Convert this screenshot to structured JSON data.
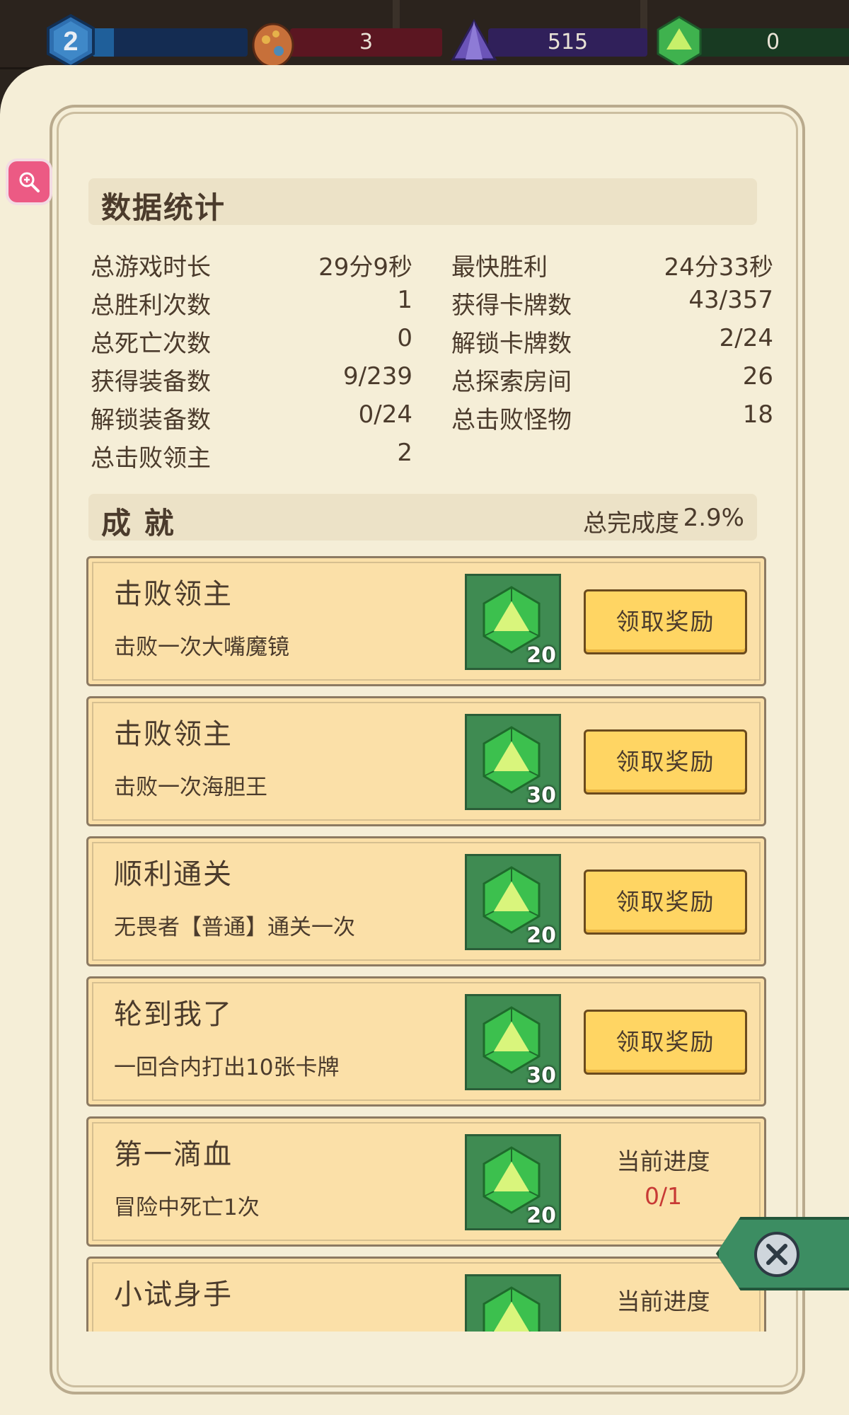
{
  "resources": {
    "level": "2",
    "red": "3",
    "purple": "515",
    "green": "0"
  },
  "stats": {
    "title": "数据统计",
    "left": [
      {
        "label": "总游戏时长",
        "value": "29分9秒"
      },
      {
        "label": "总胜利次数",
        "value": "1"
      },
      {
        "label": "总死亡次数",
        "value": "0"
      },
      {
        "label": "获得装备数",
        "value": "9/239"
      },
      {
        "label": "解锁装备数",
        "value": "0/24"
      },
      {
        "label": "总击败领主",
        "value": "2"
      }
    ],
    "right": [
      {
        "label": "最快胜利",
        "value": "24分33秒"
      },
      {
        "label": "获得卡牌数",
        "value": "43/357"
      },
      {
        "label": "解锁卡牌数",
        "value": "2/24"
      },
      {
        "label": "总探索房间",
        "value": "26"
      },
      {
        "label": "总击败怪物",
        "value": "18"
      }
    ]
  },
  "achievements": {
    "title": "成 就",
    "completion_label": "总完成度",
    "completion_value": "2.9%",
    "claim_label": "领取奖励",
    "progress_label": "当前进度",
    "items": [
      {
        "title": "击败领主",
        "desc": "击败一次大嘴魔镜",
        "reward": "20",
        "state": "claim"
      },
      {
        "title": "击败领主",
        "desc": "击败一次海胆王",
        "reward": "30",
        "state": "claim"
      },
      {
        "title": "顺利通关",
        "desc": "无畏者【普通】通关一次",
        "reward": "20",
        "state": "claim"
      },
      {
        "title": "轮到我了",
        "desc": "一回合内打出10张卡牌",
        "reward": "30",
        "state": "claim"
      },
      {
        "title": "第一滴血",
        "desc": "冒险中死亡1次",
        "reward": "20",
        "state": "progress",
        "progress": "0/1"
      },
      {
        "title": "小试身手",
        "desc": "",
        "reward": "",
        "state": "progress",
        "progress": ""
      }
    ]
  },
  "icons": {
    "level": "hexagon-level-icon",
    "red": "red-egg-icon",
    "purple": "purple-crystal-icon",
    "green": "green-d20-icon",
    "reward": "green-d20-gem-icon",
    "zoom": "zoom-in-icon",
    "close": "close-icon"
  },
  "colors": {
    "paper": "#f5eed7",
    "card": "#fbe0a8",
    "claim_button": "#ffd563",
    "reward_bg": "#3f8b52",
    "progress_value": "#c83a35",
    "close_tab": "#3c8d62"
  }
}
